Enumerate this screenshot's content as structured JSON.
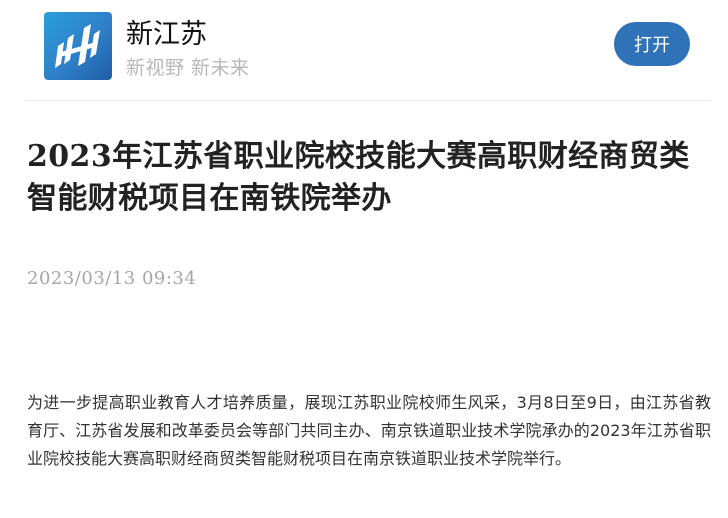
{
  "app": {
    "name": "新江苏",
    "slogan": "新视野  新未来",
    "open_button": "打开",
    "logo_icon": "xinjiangsu-logo-icon",
    "brand_color": "#2f72b8"
  },
  "article": {
    "title": "2023年江苏省职业院校技能大赛高职财经商贸类智能财税项目在南铁院举办",
    "date": "2023/03/13  09:34",
    "paragraph": "为进一步提高职业教育人才培养质量，展现江苏职业院校师生风采，3月8日至9日，由江苏省教育厅、江苏省发展和改革委员会等部门共同主办、南京铁道职业技术学院承办的2023年江苏省职业院校技能大赛高职财经商贸类智能财税项目在南京铁道职业技术学院举行。"
  }
}
